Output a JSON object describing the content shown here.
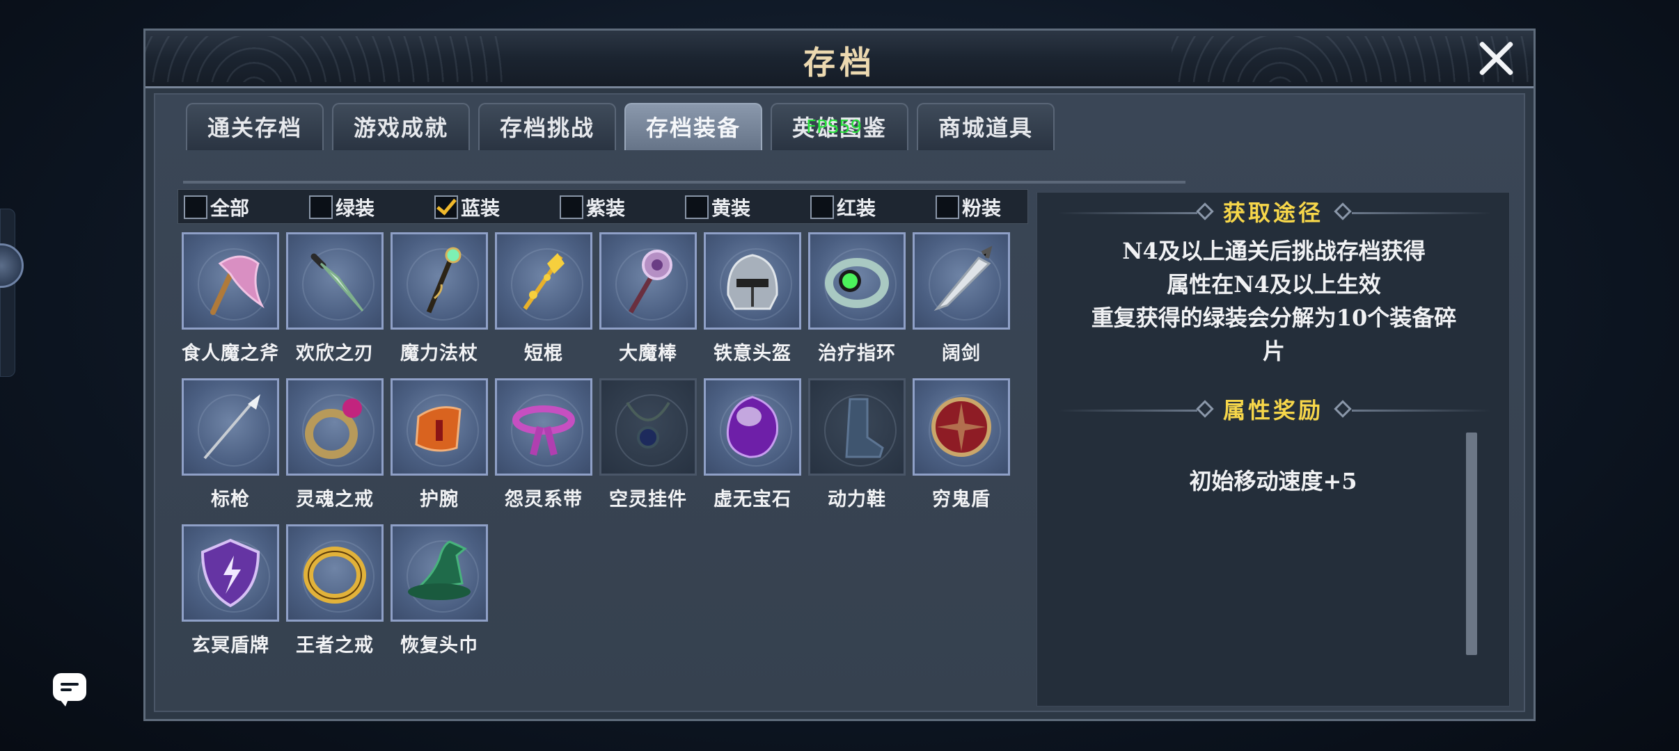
{
  "window": {
    "title": "存档",
    "close_icon": "close-icon"
  },
  "tabs": [
    {
      "label": "通关存档",
      "active": false
    },
    {
      "label": "游戏成就",
      "active": false
    },
    {
      "label": "存档挑战",
      "active": false
    },
    {
      "label": "存档装备",
      "active": true
    },
    {
      "label": "英雄图鉴",
      "active": false
    },
    {
      "label": "商城道具",
      "active": false
    }
  ],
  "overlay": {
    "fps": "FPS59"
  },
  "filters": [
    {
      "label": "全部",
      "checked": false
    },
    {
      "label": "绿装",
      "checked": false
    },
    {
      "label": "蓝装",
      "checked": true
    },
    {
      "label": "紫装",
      "checked": false
    },
    {
      "label": "黄装",
      "checked": false
    },
    {
      "label": "红装",
      "checked": false
    },
    {
      "label": "粉装",
      "checked": false
    }
  ],
  "items": [
    {
      "name": "食人魔之斧",
      "icon": "axe-icon"
    },
    {
      "name": "欢欣之刃",
      "icon": "blade-icon"
    },
    {
      "name": "魔力法杖",
      "icon": "staff-icon"
    },
    {
      "name": "短棍",
      "icon": "short-staff-icon"
    },
    {
      "name": "大魔棒",
      "icon": "magic-wand-icon"
    },
    {
      "name": "铁意头盔",
      "icon": "helmet-icon"
    },
    {
      "name": "治疗指环",
      "icon": "ring-icon"
    },
    {
      "name": "阔剑",
      "icon": "broadsword-icon"
    },
    {
      "name": "标枪",
      "icon": "javelin-icon"
    },
    {
      "name": "灵魂之戒",
      "icon": "soul-ring-icon"
    },
    {
      "name": "护腕",
      "icon": "bracer-icon"
    },
    {
      "name": "怨灵系带",
      "icon": "sash-icon"
    },
    {
      "name": "空灵挂件",
      "icon": "pendant-icon"
    },
    {
      "name": "虚无宝石",
      "icon": "gem-icon"
    },
    {
      "name": "动力鞋",
      "icon": "boots-icon"
    },
    {
      "name": "穷鬼盾",
      "icon": "buckler-icon"
    },
    {
      "name": "玄冥盾牌",
      "icon": "shield-icon"
    },
    {
      "name": "王者之戒",
      "icon": "gold-ring-icon"
    },
    {
      "name": "恢复头巾",
      "icon": "hat-icon"
    }
  ],
  "detail": {
    "acquire_title": "获取途径",
    "acquire_lines": [
      "N4及以上通关后挑战存档获得",
      "属性在N4及以上生效",
      "重复获得的绿装会分解为10个装备碎",
      "片"
    ],
    "reward_title": "属性奖励",
    "reward_text": "初始移动速度+5"
  },
  "colors": {
    "accent_title": "#f6d64a",
    "checkbox_check": "#f0b92c",
    "fps_text": "#27e03a"
  }
}
